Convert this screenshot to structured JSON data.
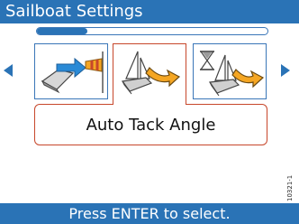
{
  "title": "Sailboat Settings",
  "progress": 0.22,
  "icons": {
    "left": "boat-wind-vane-icon",
    "center": "auto-tack-icon",
    "right": "timer-tack-icon"
  },
  "selected_label": "Auto Tack Angle",
  "hint": "Press ENTER to select.",
  "side_code": "10321-1",
  "colors": {
    "accent": "#2a73b6",
    "highlight": "#c7472b",
    "arrow": "#f5a623"
  }
}
